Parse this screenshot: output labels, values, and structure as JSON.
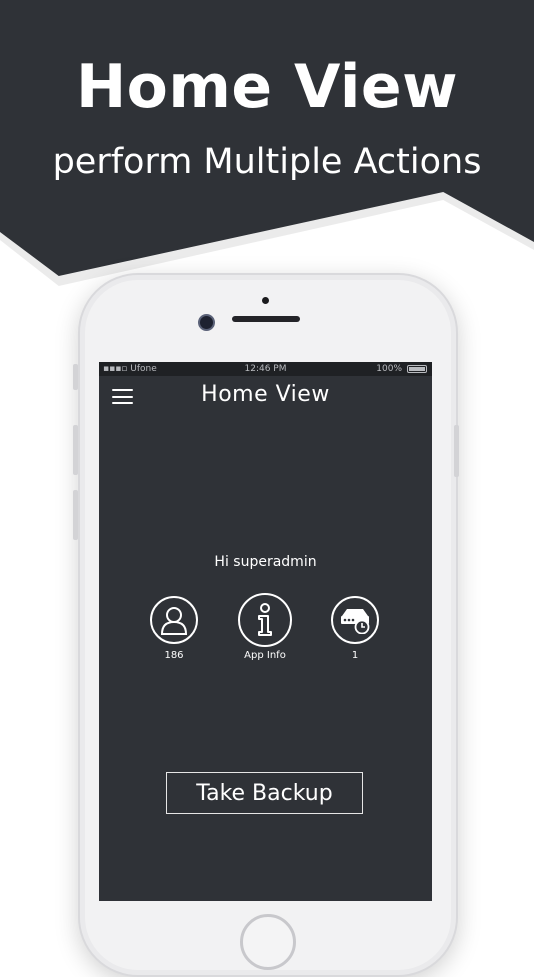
{
  "banner": {
    "title": "Home View",
    "subtitle": "perform Multiple Actions"
  },
  "statusbar": {
    "carrier": "Ufone",
    "time": "12:46 PM",
    "battery": "100%"
  },
  "app": {
    "nav_title": "Home View",
    "greeting": "Hi superadmin",
    "actions": [
      {
        "label": "186",
        "icon": "user-icon"
      },
      {
        "label": "App Info",
        "icon": "info-icon"
      },
      {
        "label": "1",
        "icon": "server-clock-icon"
      }
    ],
    "backup_label": "Take Backup"
  },
  "colors": {
    "background_dark": "#2f3237",
    "text": "#ffffff",
    "page_bg": "#ffffff"
  }
}
